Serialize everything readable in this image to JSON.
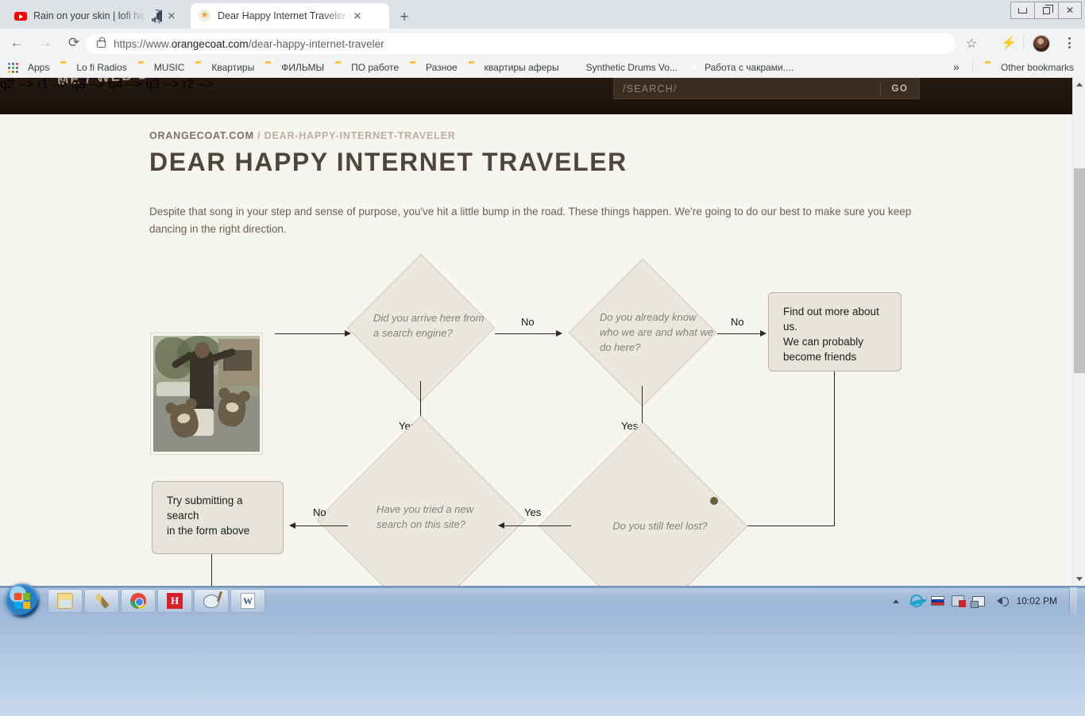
{
  "browser": {
    "tabs": [
      {
        "title": "Rain on your skin | lofi hip ho",
        "favicon": "youtube-icon",
        "audio": true,
        "active": false
      },
      {
        "title": "Dear Happy Internet Traveler | W",
        "favicon": "star-icon",
        "audio": false,
        "active": true
      }
    ],
    "new_tab_label": "+",
    "window_controls": {
      "minimize": "–",
      "restore": "❐",
      "close": "✕"
    },
    "nav": {
      "back": "←",
      "forward": "→",
      "reload": "⟳"
    },
    "omnibox": {
      "url_scheme": "https://www.",
      "url_domain": "orangecoat.com",
      "url_path": "/dear-happy-internet-traveler",
      "full_url": "https://www.orangecoat.com/dear-happy-internet-traveler",
      "lock_icon": "lock-icon",
      "star_icon": "☆",
      "bolt_icon": "⚡"
    },
    "bookmarks": [
      {
        "label": "Apps",
        "icon": "apps-grid-icon"
      },
      {
        "label": "Lo fi Radios",
        "icon": "folder-icon"
      },
      {
        "label": "MUSIC",
        "icon": "folder-icon"
      },
      {
        "label": "Квартиры",
        "icon": "folder-icon"
      },
      {
        "label": "ФИЛЬМЫ",
        "icon": "folder-icon"
      },
      {
        "label": "ПО работе",
        "icon": "folder-icon"
      },
      {
        "label": "Разное",
        "icon": "folder-icon"
      },
      {
        "label": "квартиры аферы",
        "icon": "folder-icon"
      },
      {
        "label": "Synthetic Drums Vo...",
        "icon": "bee-icon"
      },
      {
        "label": "Работа с чакрами....",
        "icon": "youtube-icon"
      }
    ],
    "bookmarks_overflow": "»",
    "other_bookmarks": "Other bookmarks"
  },
  "site": {
    "logo_fragment": "ME / WEB D",
    "search": {
      "placeholder": "/SEARCH/",
      "value": "",
      "go_label": "GO"
    },
    "breadcrumb": {
      "root": "ORANGECOAT.COM",
      "separator": "/",
      "current": "DEAR-HAPPY-INTERNET-TRAVELER"
    },
    "title": "DEAR HAPPY INTERNET TRAVELER",
    "intro": "Despite that song in your step and sense of purpose, you've hit a little bump in the road. These things happen. We're going to do our best to make sure you keep dancing in the right direction.",
    "photo_alt": "man jumping with cartoon koalas"
  },
  "flowchart": {
    "nodes": [
      {
        "id": "q1",
        "shape": "diamond",
        "text": "Did you arrive here from a search engine?"
      },
      {
        "id": "q2",
        "shape": "diamond",
        "text": "Do you already know who we are and what we do here?"
      },
      {
        "id": "r1",
        "shape": "box",
        "text": "Find out more about us. We can probably become friends"
      },
      {
        "id": "q3",
        "shape": "diamond",
        "text": "Have you tried a new search on this site?"
      },
      {
        "id": "q4",
        "shape": "diamond",
        "text": "Do you still feel lost?"
      },
      {
        "id": "r2",
        "shape": "box",
        "text": "Try submitting a search in the form above"
      }
    ],
    "node_text": {
      "q1_line1": "Did you arrive here from",
      "q1_line2": "a search engine?",
      "q2_line1": "Do you already know",
      "q2_line2": "who we are and what we",
      "q2_line3": "do here?",
      "r1_line1": "Find out more about us.",
      "r1_line2": "We can probably",
      "r1_line3": "become friends",
      "q3_line1": "Have you tried a new",
      "q3_line2": "search on this site?",
      "q4_line1": "Do you still feel lost?",
      "r2_line1": "Try submitting a search",
      "r2_line2": "in the form above"
    },
    "edge_labels": {
      "q1_no": "No",
      "q1_yes": "Yes",
      "q2_no": "No",
      "q2_yes": "Yes",
      "q3_no": "No",
      "q4_yes": "Yes"
    },
    "colors": {
      "node_fill": "#eae7df",
      "node_stroke": "#cfc9ba",
      "box_fill": "#e7e4dc",
      "box_stroke": "#b9b3a5",
      "edge": "#2b2620",
      "page_bg": "#f7f5ef",
      "dot": "#6b6038"
    }
  },
  "scrollbar": {
    "up_arrow": "▲",
    "down_arrow": "▼"
  },
  "taskbar": {
    "start_label": "Start",
    "items": [
      {
        "name": "file-explorer",
        "icon": "explorer-icon"
      },
      {
        "name": "paint-tool",
        "icon": "brush-icon"
      },
      {
        "name": "google-chrome",
        "icon": "chrome-icon"
      },
      {
        "name": "h-app",
        "icon": "h-icon"
      },
      {
        "name": "palette-app",
        "icon": "palette-icon"
      },
      {
        "name": "word",
        "icon": "word-icon"
      }
    ],
    "tray": [
      {
        "name": "show-hidden-icons",
        "icon": "chevron-up-icon"
      },
      {
        "name": "internet-explorer",
        "icon": "ie-icon"
      },
      {
        "name": "language-russian",
        "icon": "ru-flag-icon"
      },
      {
        "name": "network-problem",
        "icon": "network-plug-icon"
      },
      {
        "name": "network-status",
        "icon": "network-monitor-icon"
      },
      {
        "name": "volume",
        "icon": "speaker-icon"
      }
    ],
    "clock": "10:02 PM"
  }
}
